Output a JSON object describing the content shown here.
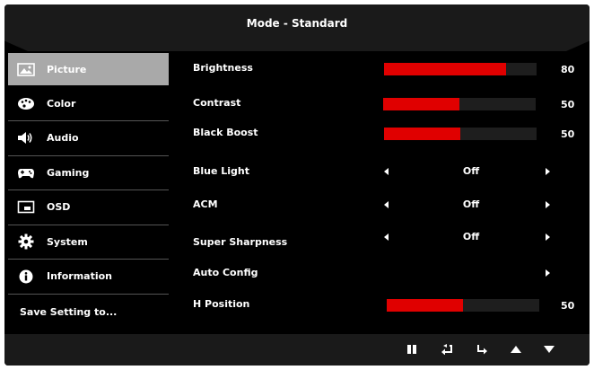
{
  "header": {
    "title": "Mode - Standard"
  },
  "sidebar": {
    "items": [
      {
        "label": "Picture",
        "icon": "picture-icon",
        "selected": true
      },
      {
        "label": "Color",
        "icon": "palette-icon"
      },
      {
        "label": "Audio",
        "icon": "speaker-icon"
      },
      {
        "label": "Gaming",
        "icon": "gamepad-icon"
      },
      {
        "label": "OSD",
        "icon": "osd-window-icon"
      },
      {
        "label": "System",
        "icon": "gear-icon"
      },
      {
        "label": "Information",
        "icon": "info-icon"
      }
    ],
    "save_label": "Save Setting to..."
  },
  "settings": {
    "brightness": {
      "label": "Brightness",
      "value": "80",
      "level": 80
    },
    "contrast": {
      "label": "Contrast",
      "value": "50",
      "level": 50
    },
    "black_boost": {
      "label": "Black Boost",
      "value": "50",
      "level": 50
    },
    "blue_light": {
      "label": "Blue Light",
      "value": "Off"
    },
    "acm": {
      "label": "ACM",
      "value": "Off"
    },
    "super_sharpness": {
      "label": "Super Sharpness",
      "value": "Off"
    },
    "auto_config": {
      "label": "Auto Config"
    },
    "h_position": {
      "label": "H Position",
      "value": "50",
      "level": 50
    }
  },
  "footer": {
    "buttons": [
      "pause-icon",
      "back-icon",
      "enter-icon",
      "up-arrow-icon",
      "down-arrow-icon"
    ]
  },
  "colors": {
    "accent": "#e00000",
    "selected": "#a9a9a9",
    "background": "#000000"
  }
}
